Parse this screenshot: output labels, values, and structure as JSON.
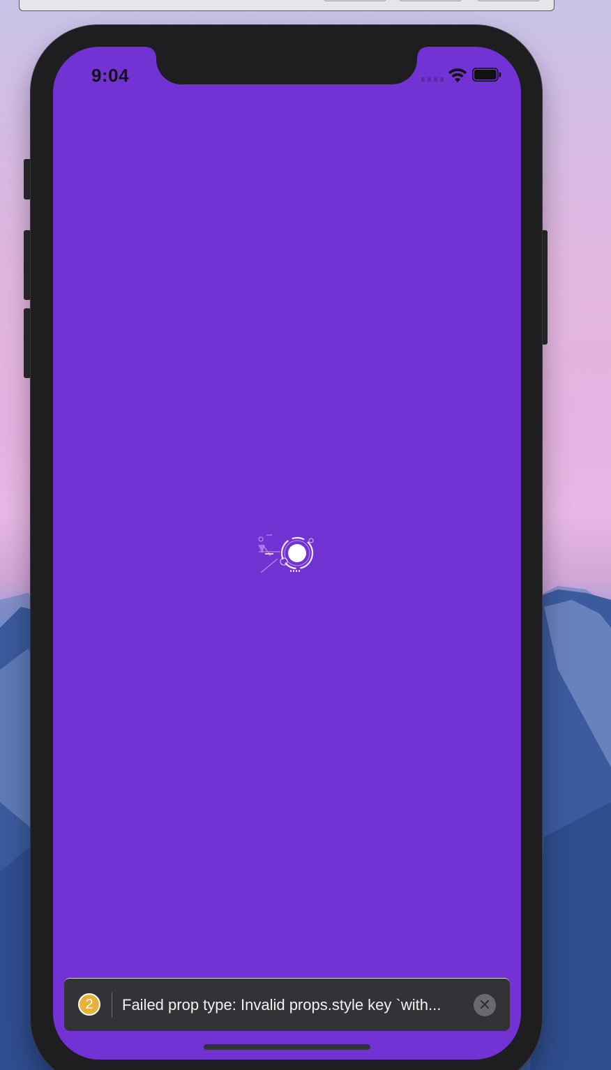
{
  "status_bar": {
    "time": "9:04"
  },
  "warning_toast": {
    "count": "2",
    "message": "Failed prop type: Invalid props.style key `with...",
    "dismiss_symbol": "✕"
  },
  "colors": {
    "screen_background": "#7332d3",
    "warning_badge": "#e8b23a",
    "toast_background": "#333236"
  },
  "icons": [
    "cellular-signal-icon",
    "wifi-icon",
    "battery-icon",
    "loading-spinner-icon",
    "close-icon"
  ]
}
